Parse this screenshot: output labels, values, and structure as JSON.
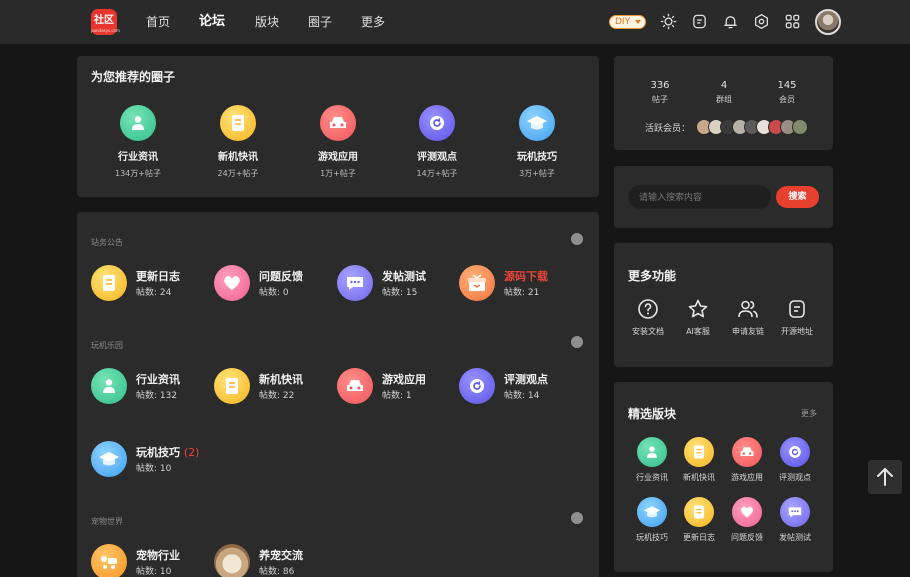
{
  "header": {
    "logo_text": "社区",
    "logo_subtext": "pandasys.com",
    "nav": [
      "首页",
      "论坛",
      "版块",
      "圈子",
      "更多"
    ],
    "active_nav": "论坛",
    "diy_label": "DIY",
    "icons": [
      "sun-icon",
      "note-icon",
      "bell-icon",
      "settings-icon",
      "apps-icon"
    ]
  },
  "recommend": {
    "title": "为您推荐的圈子",
    "items": [
      {
        "name": "行业资讯",
        "sub": "134万+帖子",
        "icon": "person-icon",
        "color": "#3ec596"
      },
      {
        "name": "新机快讯",
        "sub": "24万+帖子",
        "icon": "document-icon",
        "color": "#f8b928"
      },
      {
        "name": "游戏应用",
        "sub": "1万+帖子",
        "icon": "car-icon",
        "color": "#f25f63"
      },
      {
        "name": "评测观点",
        "sub": "14万+帖子",
        "icon": "refresh-icon",
        "color": "#6059ea"
      },
      {
        "name": "玩机技巧",
        "sub": "3万+帖子",
        "icon": "graduation-cap-icon",
        "color": "#45a4f0"
      }
    ]
  },
  "sections": [
    {
      "label": "站务公告",
      "forums": [
        {
          "name": "更新日志",
          "count": "帖数: 24",
          "icon": "document-icon",
          "highlight": false
        },
        {
          "name": "问题反馈",
          "count": "帖数: 0",
          "icon": "heart-icon",
          "highlight": false
        },
        {
          "name": "发帖测试",
          "count": "帖数: 15",
          "icon": "chat-icon",
          "highlight": false
        },
        {
          "name": "源码下载",
          "count": "帖数: 21",
          "icon": "gift-icon",
          "highlight": true
        }
      ]
    },
    {
      "label": "玩机乐园",
      "forums": [
        {
          "name": "行业资讯",
          "count": "帖数: 132",
          "icon": "person-icon"
        },
        {
          "name": "新机快讯",
          "count": "帖数: 22",
          "icon": "document-icon"
        },
        {
          "name": "游戏应用",
          "count": "帖数: 1",
          "icon": "car-icon"
        },
        {
          "name": "评测观点",
          "count": "帖数: 14",
          "icon": "refresh-icon"
        },
        {
          "name": "玩机技巧",
          "badge": "(2)",
          "count": "帖数: 10",
          "icon": "graduation-cap-icon"
        }
      ]
    },
    {
      "label": "宠物世界",
      "forums": [
        {
          "name": "宠物行业",
          "count": "帖数: 10",
          "icon": "dog-icon"
        },
        {
          "name": "养宠交流",
          "count": "帖数: 86",
          "icon": "cat-avatar-icon"
        }
      ]
    }
  ],
  "stats": [
    {
      "value": "336",
      "label": "帖子"
    },
    {
      "value": "4",
      "label": "群组"
    },
    {
      "value": "145",
      "label": "会员"
    }
  ],
  "active_members_label": "活跃会员：",
  "search": {
    "placeholder": "请输入搜索内容",
    "button": "搜索"
  },
  "functions": {
    "title": "更多功能",
    "items": [
      {
        "label": "安装文档",
        "icon": "question-icon"
      },
      {
        "label": "AI客服",
        "icon": "star-icon"
      },
      {
        "label": "申请友链",
        "icon": "users-icon"
      },
      {
        "label": "开源地址",
        "icon": "note-icon"
      }
    ]
  },
  "selected": {
    "title": "精选版块",
    "more": "更多",
    "items": [
      {
        "label": "行业资讯",
        "icon": "person-icon"
      },
      {
        "label": "新机快讯",
        "icon": "document-icon"
      },
      {
        "label": "游戏应用",
        "icon": "car-icon"
      },
      {
        "label": "评测观点",
        "icon": "refresh-icon"
      },
      {
        "label": "玩机技巧",
        "icon": "graduation-cap-icon"
      },
      {
        "label": "更新日志",
        "icon": "document-icon"
      },
      {
        "label": "问题反馈",
        "icon": "heart-icon"
      },
      {
        "label": "发帖测试",
        "icon": "chat-icon"
      }
    ]
  }
}
